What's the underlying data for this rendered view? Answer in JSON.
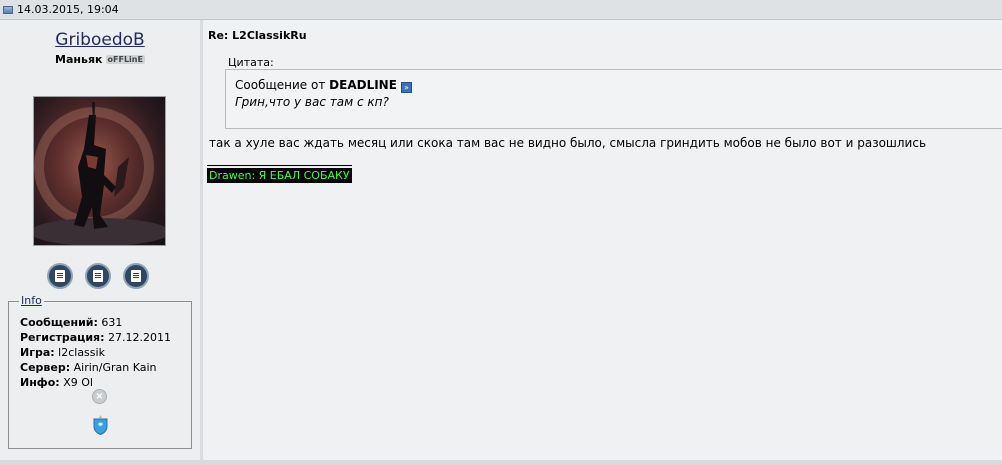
{
  "post": {
    "date": "14.03.2015, 19:04",
    "title": "Re: L2ClassikRu"
  },
  "user": {
    "username": "GriboedoB",
    "usertitle": "Маньяк",
    "status_badge": "oFFLinE"
  },
  "actions": {
    "icons": [
      "profile-icon",
      "private-message-icon",
      "user-posts-icon"
    ]
  },
  "info": {
    "legend": "Info",
    "rows": [
      {
        "label": "Сообщений:",
        "value": "631"
      },
      {
        "label": "Регистрация:",
        "value": "27.12.2011"
      },
      {
        "label": "Игра:",
        "value": "l2classik"
      },
      {
        "label": "Сервер:",
        "value": "Airin/Gran Kain"
      },
      {
        "label": "Инфо:",
        "value": "X9 Ol"
      }
    ],
    "status_icon_glyph": "×"
  },
  "quote": {
    "label": "Цитата:",
    "from_prefix": "Сообщение от",
    "author": "DEADLINE",
    "text": "Грин,что у вас там с кп?"
  },
  "body": {
    "text": "так а хуле вас ждать месяц или скока там вас не видно было, смысла гриндить мобов не было вот и разошлись"
  },
  "signature": {
    "text": "Drawen: Я ЕБАЛ СОБАКУ"
  },
  "colors": {
    "signature_text": "#44ff44",
    "username": "#1d2b5e"
  }
}
